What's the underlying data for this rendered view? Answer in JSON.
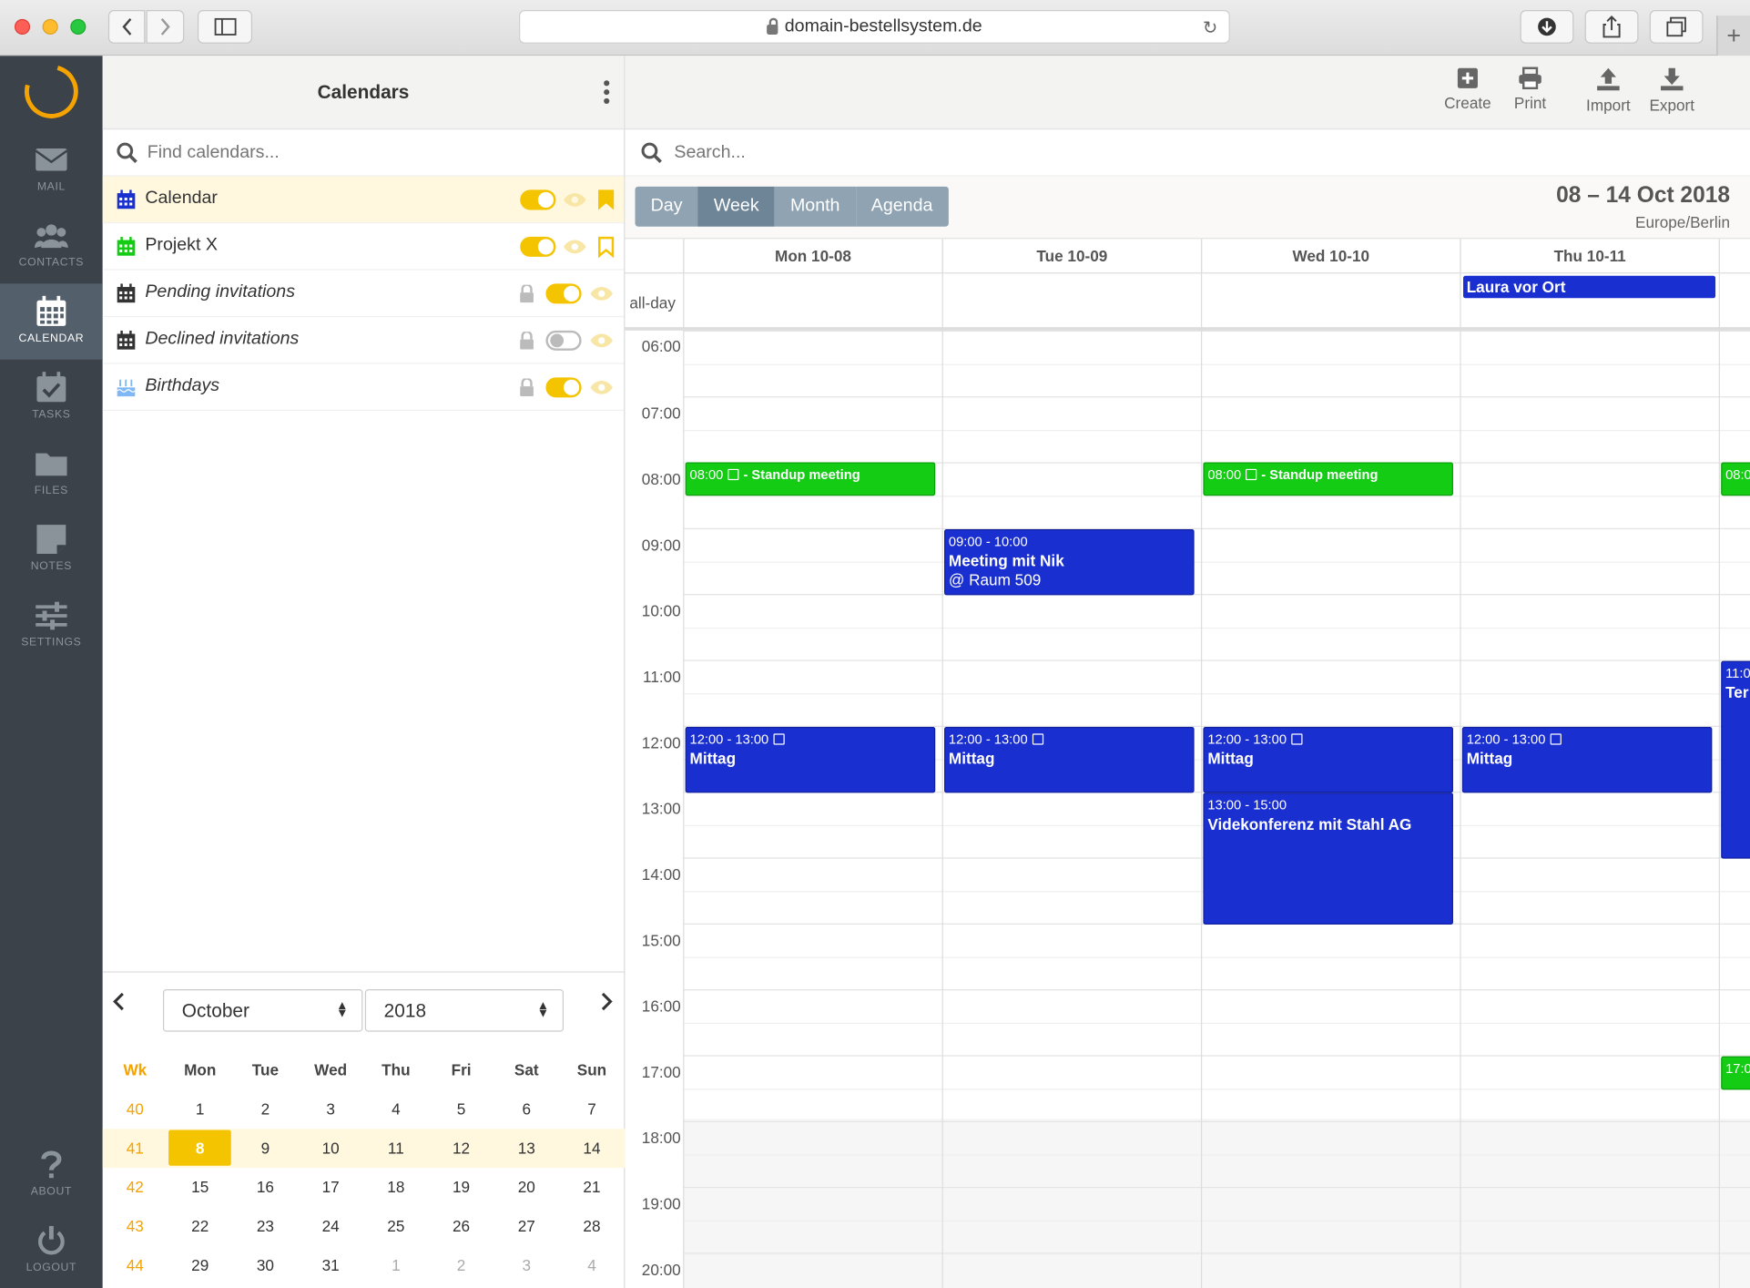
{
  "browser": {
    "url": "domain-bestellsystem.de"
  },
  "nav": {
    "items": [
      {
        "label": "MAIL"
      },
      {
        "label": "CONTACTS"
      },
      {
        "label": "CALENDAR"
      },
      {
        "label": "TASKS"
      },
      {
        "label": "FILES"
      },
      {
        "label": "NOTES"
      },
      {
        "label": "SETTINGS"
      },
      {
        "label": "ABOUT"
      },
      {
        "label": "LOGOUT"
      }
    ]
  },
  "sidebar": {
    "title": "Calendars",
    "find_placeholder": "Find calendars...",
    "calendars": [
      {
        "name": "Calendar",
        "color": "#1a2fd0"
      },
      {
        "name": "Projekt X",
        "color": "#13cc13"
      },
      {
        "name": "Pending invitations"
      },
      {
        "name": "Declined invitations"
      },
      {
        "name": "Birthdays"
      }
    ]
  },
  "minical": {
    "month": "October",
    "year": "2018",
    "headers": [
      "Wk",
      "Mon",
      "Tue",
      "Wed",
      "Thu",
      "Fri",
      "Sat",
      "Sun"
    ],
    "rows": [
      [
        "40",
        "1",
        "2",
        "3",
        "4",
        "5",
        "6",
        "7"
      ],
      [
        "41",
        "8",
        "9",
        "10",
        "11",
        "12",
        "13",
        "14"
      ],
      [
        "42",
        "15",
        "16",
        "17",
        "18",
        "19",
        "20",
        "21"
      ],
      [
        "43",
        "22",
        "23",
        "24",
        "25",
        "26",
        "27",
        "28"
      ],
      [
        "44",
        "29",
        "30",
        "31",
        "1",
        "2",
        "3",
        "4"
      ]
    ]
  },
  "toolbar": {
    "create": "Create",
    "print": "Print",
    "import": "Import",
    "export": "Export"
  },
  "main": {
    "search_placeholder": "Search...",
    "views": [
      "Day",
      "Week",
      "Month",
      "Agenda"
    ],
    "range": "08 – 14 Oct 2018",
    "timezone": "Europe/Berlin",
    "days": [
      "Mon 10-08",
      "Tue 10-09",
      "Wed 10-10",
      "Thu 10-11"
    ],
    "allday_label": "all-day",
    "hours": [
      "06:00",
      "07:00",
      "08:00",
      "09:00",
      "10:00",
      "11:00",
      "12:00",
      "13:00",
      "14:00",
      "15:00",
      "16:00",
      "17:00",
      "18:00",
      "19:00",
      "20:00"
    ]
  },
  "events": {
    "laura": "Laura vor Ort",
    "standup_mon_time": "08:00",
    "standup_mon_title": "- Standup meeting",
    "standup_wed_time": "08:00",
    "standup_wed_title": "- Standup meeting",
    "standup_fri_time": "08:0",
    "nik_time": "09:00 - 10:00",
    "nik_title": "Meeting mit Nik",
    "nik_place": "@ Raum 509",
    "mittag_mon_time": "12:00 - 13:00",
    "mittag_mon_title": "Mittag",
    "mittag_tue_time": "12:00 - 13:00",
    "mittag_tue_title": "Mittag",
    "mittag_wed_time": "12:00 - 13:00",
    "mittag_wed_title": "Mittag",
    "mittag_thu_time": "12:00 - 13:00",
    "mittag_thu_title": "Mittag",
    "video_time": "13:00 - 15:00",
    "video_title": "Videkonferenz mit Stahl AG",
    "fri_11_time": "11:0",
    "fri_11_title": "Ter",
    "fri_17_time": "17:0"
  }
}
